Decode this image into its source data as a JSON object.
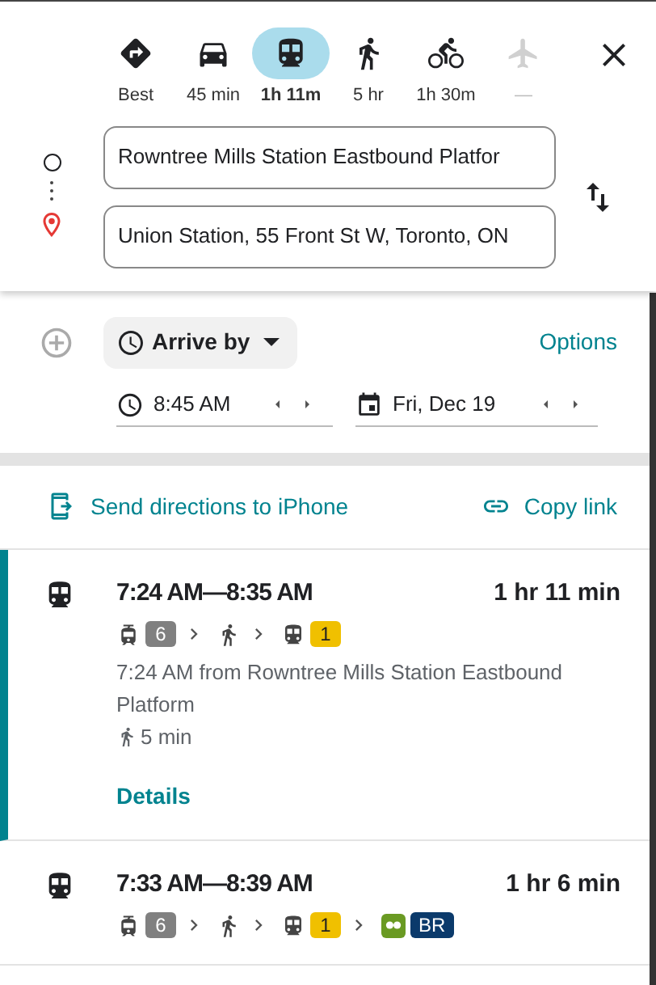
{
  "modes": [
    {
      "kind": "best",
      "label": "Best",
      "selected": false,
      "disabled": false
    },
    {
      "kind": "car",
      "label": "45 min",
      "selected": false,
      "disabled": false
    },
    {
      "kind": "transit",
      "label": "1h 11m",
      "selected": true,
      "disabled": false
    },
    {
      "kind": "walk",
      "label": "5 hr",
      "selected": false,
      "disabled": false
    },
    {
      "kind": "bike",
      "label": "1h 30m",
      "selected": false,
      "disabled": false
    },
    {
      "kind": "flight",
      "label": "—",
      "selected": false,
      "disabled": true
    }
  ],
  "origin": {
    "value": "Rowntree Mills Station Eastbound Platfor"
  },
  "destination": {
    "value": "Union Station, 55 Front St W, Toronto, ON"
  },
  "time_mode": {
    "label": "Arrive by"
  },
  "options_link": "Options",
  "time": {
    "value": "8:45 AM"
  },
  "date": {
    "value": "Fri, Dec 19"
  },
  "send_link": "Send directions to iPhone",
  "copy_link": "Copy link",
  "routes": [
    {
      "selected": true,
      "times": "7:24 AM—8:35 AM",
      "duration": "1 hr 11 min",
      "segments": [
        {
          "kind": "tram",
          "badge": "6",
          "color": "#808080"
        },
        {
          "kind": "walk"
        },
        {
          "kind": "subway",
          "badge": "1",
          "color": "#f0c000"
        }
      ],
      "description": "7:24 AM from Rowntree Mills Station Eastbound Platform",
      "walk": "5 min",
      "details": "Details"
    },
    {
      "selected": false,
      "times": "7:33 AM—8:39 AM",
      "duration": "1 hr 6 min",
      "segments": [
        {
          "kind": "tram",
          "badge": "6",
          "color": "#808080"
        },
        {
          "kind": "walk"
        },
        {
          "kind": "subway",
          "badge": "1",
          "color": "#f0c000"
        },
        {
          "kind": "train",
          "badge": "BR",
          "color": "#0b3a6b"
        }
      ]
    }
  ]
}
